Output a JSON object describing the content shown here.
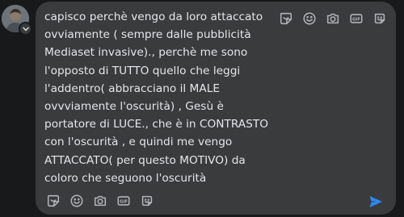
{
  "comment": {
    "text": "capisco perchè vengo da loro attaccato\novviamente ( sempre dalle pubblicità\nMediaset invasive)., perchè me sono\nl'opposto di TUTTO quello che leggi\nl'addentro( abbracciano il MALE\novvviamente l'oscurità) , Gesù è\nportatore di LUCE., che è in CONTRASTO\ncon l'oscurità , e quindi me vengo\nATTACCATO( per questo MOTIVO) da\ncoloro che seguono l'oscurità"
  },
  "composer_icons": [
    "sticker-icon",
    "emoji-icon",
    "camera-icon",
    "gif-icon",
    "avatar-sticker-icon"
  ],
  "send_icon": "send-icon",
  "colors": {
    "background": "#18191a",
    "composer": "#3a3b3c",
    "text": "#e4e6eb",
    "icon": "#b0b3b8",
    "send": "#2d88ff"
  }
}
